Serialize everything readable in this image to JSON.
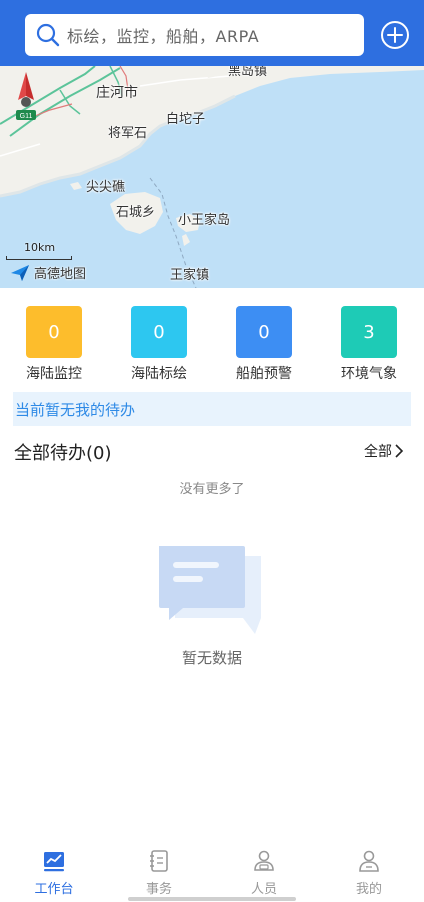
{
  "search": {
    "placeholder": "标绘，监控，船舶，ARPA"
  },
  "map": {
    "labels": {
      "heidao": "黑岛镇",
      "zhuanghe": "庄河市",
      "baituozi": "白坨子",
      "jiangjunshi": "将军石",
      "jianjiaojiao": "尖尖礁",
      "shichengxiang": "石城乡",
      "xiaowangjiadao": "小王家岛",
      "wangjiazhen": "王家镇"
    },
    "highway_shield": "G11",
    "scale": "10km",
    "provider": "高德地图"
  },
  "stats": [
    {
      "value": "0",
      "label": "海陆监控",
      "color": "#fdbd2c"
    },
    {
      "value": "0",
      "label": "海陆标绘",
      "color": "#2dc7f0"
    },
    {
      "value": "0",
      "label": "船舶预警",
      "color": "#3d8ef3"
    },
    {
      "value": "3",
      "label": "环境气象",
      "color": "#1ecbb6"
    }
  ],
  "notice": "当前暂无我的待办",
  "todo": {
    "title": "全部待办(0)",
    "all_label": "全部"
  },
  "list_footer": "没有更多了",
  "empty": "暂无数据",
  "tabs": [
    {
      "label": "工作台",
      "icon": "chart-icon",
      "active": true
    },
    {
      "label": "事务",
      "icon": "notebook-icon",
      "active": false
    },
    {
      "label": "人员",
      "icon": "people-icon",
      "active": false
    },
    {
      "label": "我的",
      "icon": "user-icon",
      "active": false
    }
  ],
  "colors": {
    "primary": "#2e6fe0",
    "notice_bg": "#e8f3fd",
    "notice_text": "#2e8ae6"
  }
}
